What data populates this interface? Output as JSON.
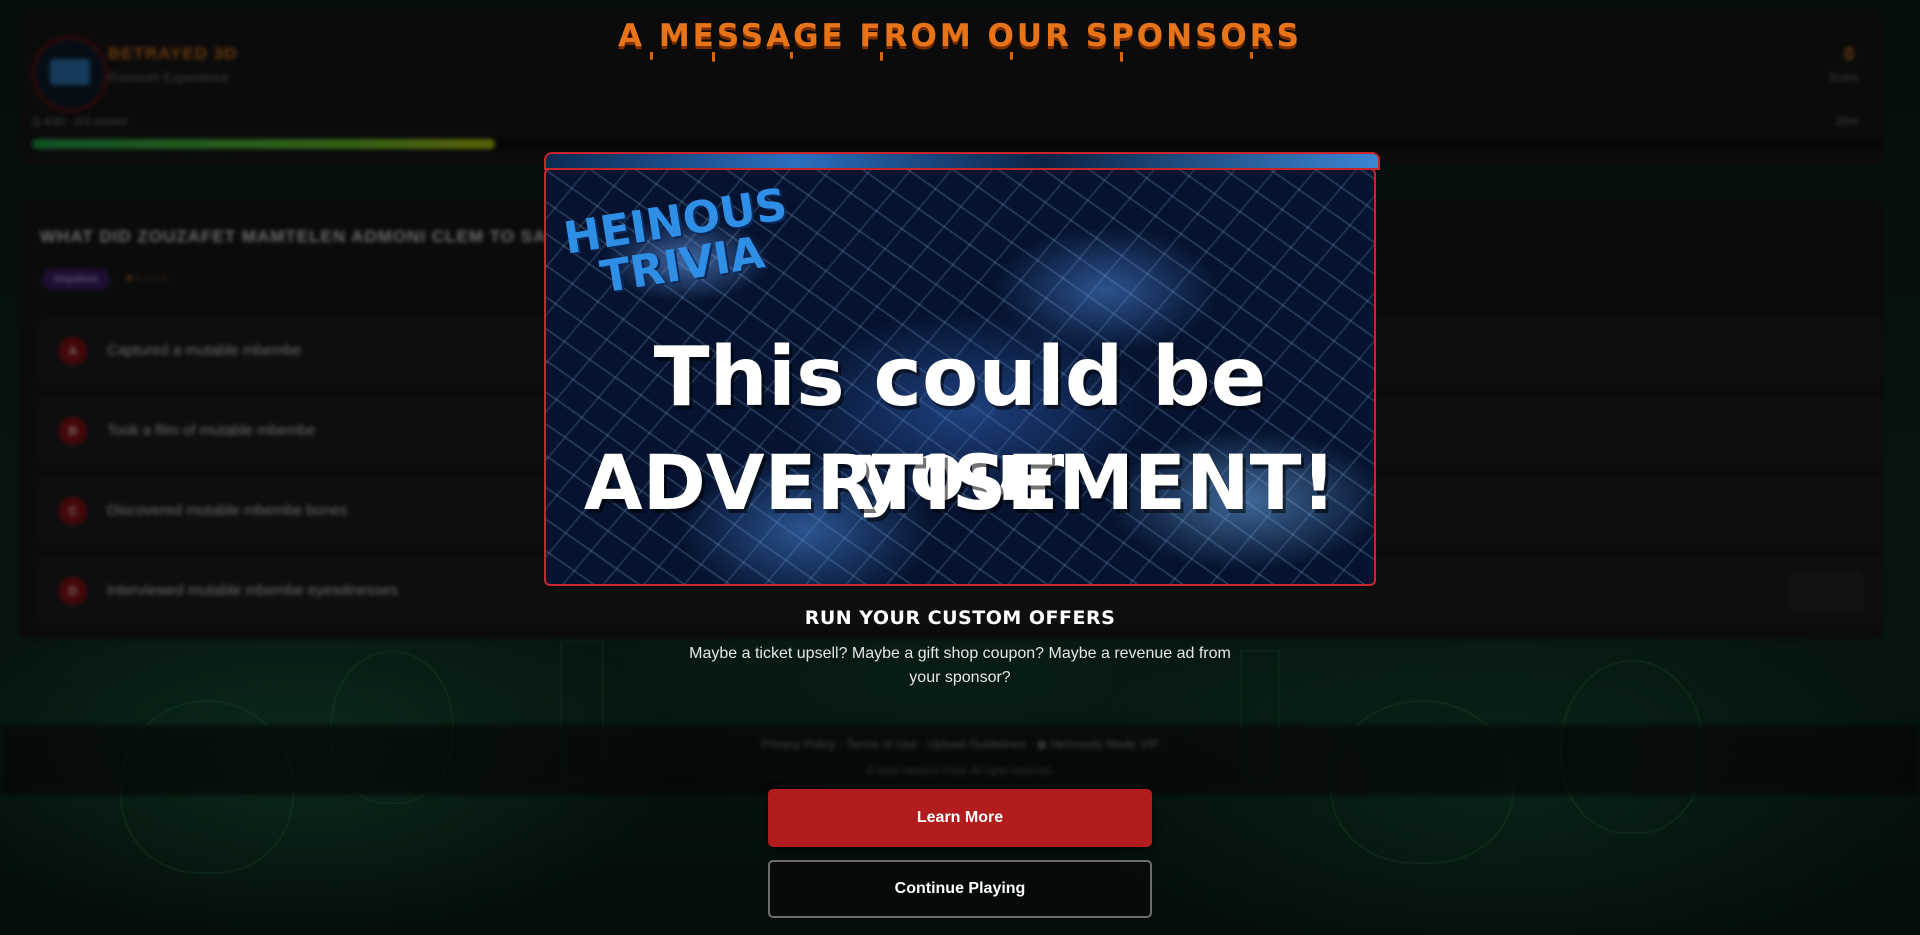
{
  "game": {
    "title": "BETRAYED 3D",
    "subtitle": "Premium Experience",
    "score_value": "0",
    "score_label": "Score",
    "progress_text": "Q 4/30 · 0/3 correct",
    "progress_pct": "25%",
    "progress_fraction": 0.25,
    "question": "WHAT DID ZOUZAFET MAMTELEN ADMONI CLEM TO SAVE",
    "category_tag": "Hopeless",
    "difficulty": "●○○○○",
    "answers": [
      {
        "letter": "A",
        "text": "Captured a mutable mbembe"
      },
      {
        "letter": "B",
        "text": "Took a film of mutable mbembe"
      },
      {
        "letter": "C",
        "text": "Discovered mutable mbembe bones"
      },
      {
        "letter": "D",
        "text": "Interviewed mutable mbembe eyewitnesses"
      }
    ]
  },
  "footer": {
    "links": "Privacy Policy · Terms of Use · Upload Guidelines · ◉ Heinously Made VIP",
    "copyright": "© 2025 Heinous Trivia. All rights reserved."
  },
  "modal": {
    "title": "A MESSAGE FROM OUR SPONSORS",
    "ad_brand_line1": "HEINOUS",
    "ad_brand_line2": "TRIVIA",
    "ad_headline1": "This could be your",
    "ad_headline2": "ADVERTISEMENT!",
    "offer_title": "RUN YOUR CUSTOM OFFERS",
    "offer_description": "Maybe a ticket upsell? Maybe a gift shop coupon? Maybe a revenue ad from your sponsor?",
    "learn_more_label": "Learn More",
    "continue_label": "Continue Playing"
  },
  "colors": {
    "accent_orange": "#e8741a",
    "primary_red": "#b31c1c",
    "ad_border": "#c8262a",
    "progress_green": "#1fa24c"
  }
}
